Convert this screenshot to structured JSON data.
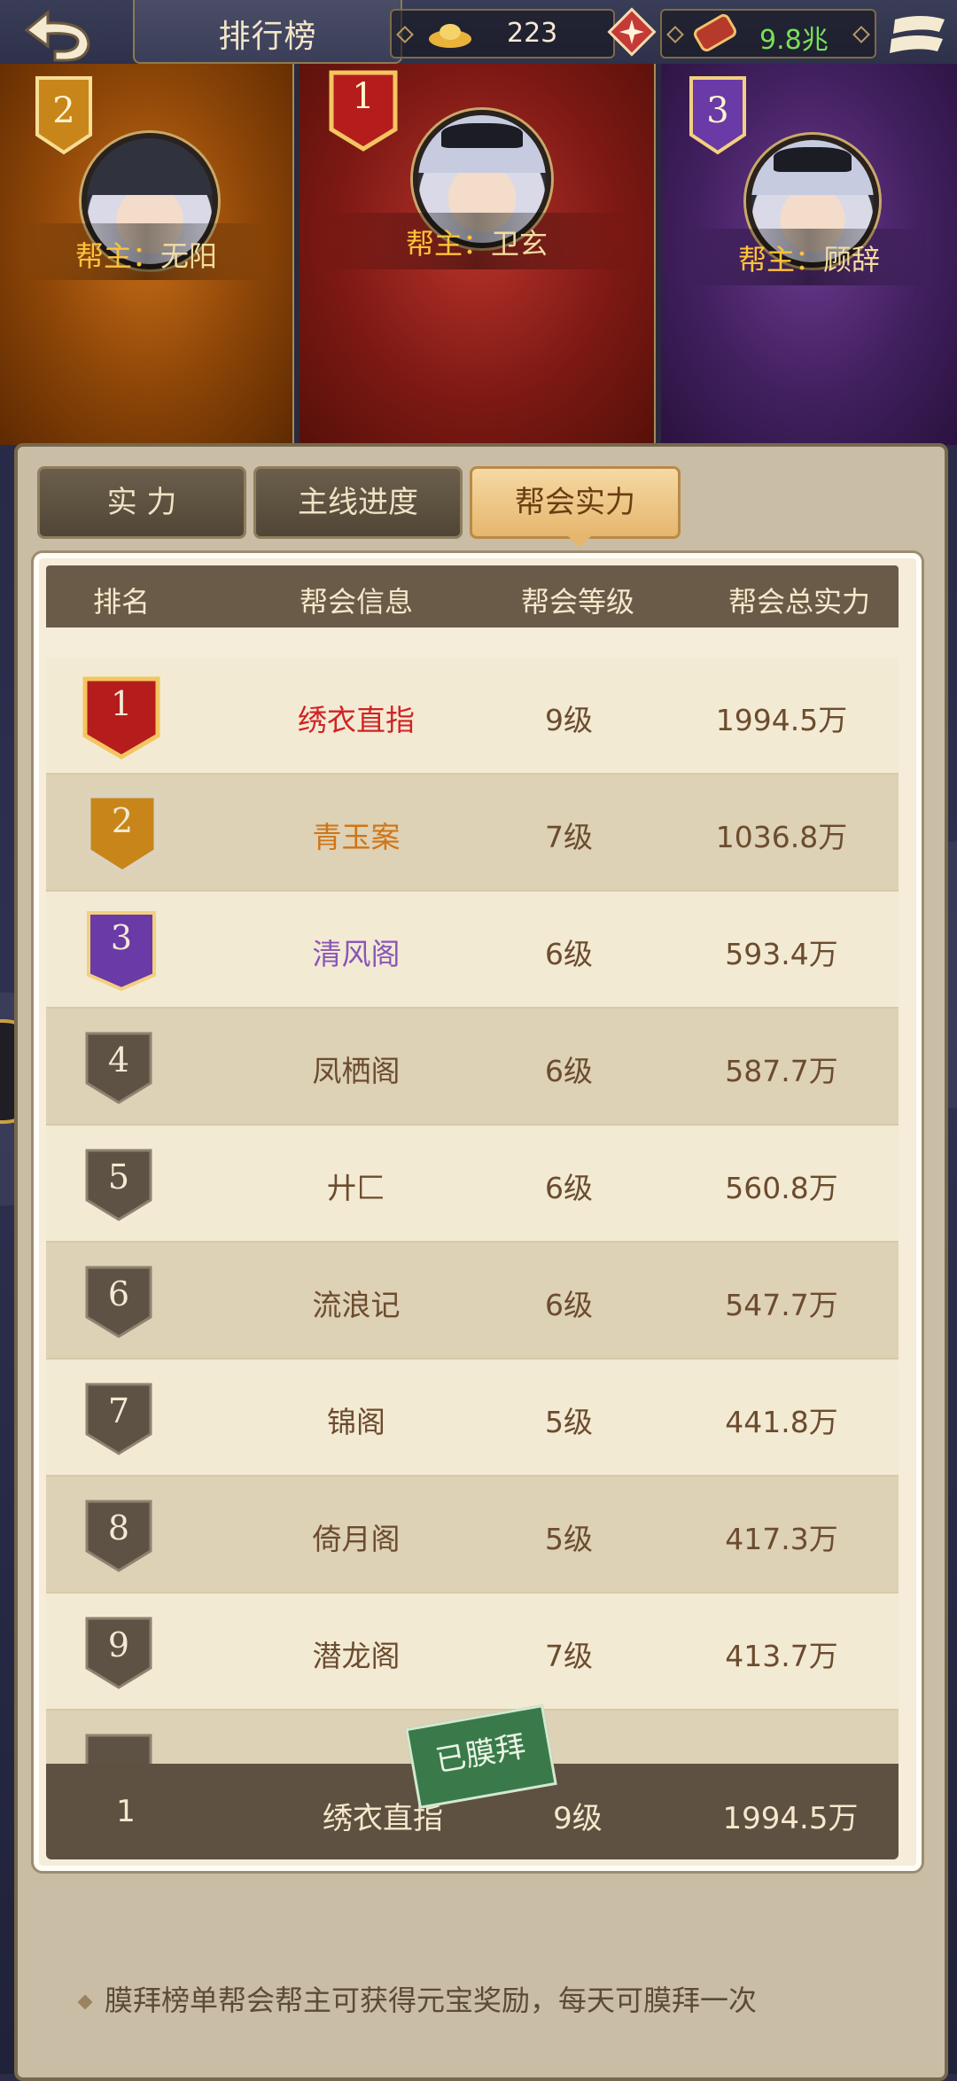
{
  "topbar": {
    "title": "排行榜",
    "currency_gold": "223",
    "currency_power": "9.8兆"
  },
  "podium": {
    "first": {
      "rank": "1",
      "prefix": "帮主：",
      "name": "卫玄"
    },
    "second": {
      "rank": "2",
      "prefix": "帮主：",
      "name": "无阳"
    },
    "third": {
      "rank": "3",
      "prefix": "帮主：",
      "name": "顾辞"
    }
  },
  "tabs": [
    {
      "label": "实 力",
      "active": false
    },
    {
      "label": "主线进度",
      "active": false
    },
    {
      "label": "帮会实力",
      "active": true
    }
  ],
  "table": {
    "headers": [
      "排名",
      "帮会信息",
      "帮会等级",
      "帮会总实力"
    ],
    "rows": [
      {
        "rank": "1",
        "name": "绣衣直指",
        "level": "9级",
        "power": "1994.5万"
      },
      {
        "rank": "2",
        "name": "青玉案",
        "level": "7级",
        "power": "1036.8万"
      },
      {
        "rank": "3",
        "name": "清风阁",
        "level": "6级",
        "power": "593.4万"
      },
      {
        "rank": "4",
        "name": "凤栖阁",
        "level": "6级",
        "power": "587.7万"
      },
      {
        "rank": "5",
        "name": "廾匚",
        "level": "6级",
        "power": "560.8万"
      },
      {
        "rank": "6",
        "name": "流浪记",
        "level": "6级",
        "power": "547.7万"
      },
      {
        "rank": "7",
        "name": "锦阁",
        "level": "5级",
        "power": "441.8万"
      },
      {
        "rank": "8",
        "name": "倚月阁",
        "level": "5级",
        "power": "417.3万"
      },
      {
        "rank": "9",
        "name": "潜龙阁",
        "level": "7级",
        "power": "413.7万"
      }
    ],
    "my_guild": {
      "rank": "1",
      "name": "绣衣直指",
      "level": "9级",
      "power": "1994.5万"
    }
  },
  "worship_stamp": "已膜拜",
  "note": "膜拜榜单帮会帮主可获得元宝奖励，每天可膜拜一次",
  "colors": {
    "rank1": "#d12323",
    "rank2": "#d07515",
    "rank3": "#8a56b8",
    "accent_gold": "#e6b66e"
  }
}
